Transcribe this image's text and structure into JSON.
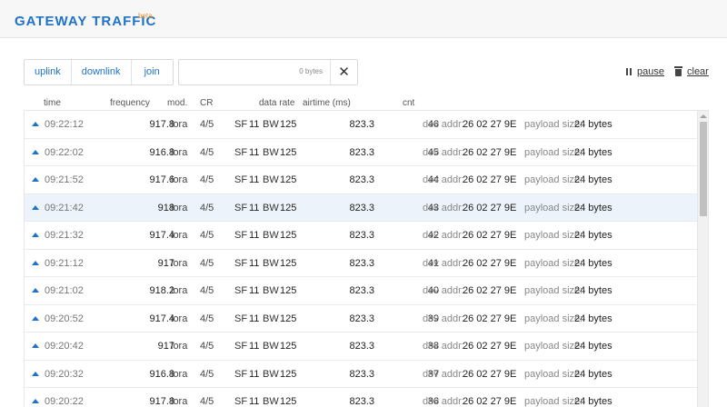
{
  "header": {
    "title": "GATEWAY TRAFFIC",
    "badge": "beta"
  },
  "filters": {
    "uplink": "uplink",
    "downlink": "downlink",
    "join": "join"
  },
  "search": {
    "size_text": "0 bytes",
    "clear_glyph": "✕"
  },
  "actions": {
    "pause": "pause",
    "clear": "clear"
  },
  "columns": {
    "time": "time",
    "frequency": "frequency",
    "mod": "mod.",
    "cr": "CR",
    "datarate": "data rate",
    "airtime": "airtime (ms)",
    "cnt": "cnt"
  },
  "labels": {
    "sf": "SF",
    "bw": "BW",
    "dev_addr": "dev addr:",
    "payload_size": "payload size:"
  },
  "rows": [
    {
      "time": "09:22:12",
      "frequency": "917.8",
      "mod": "lora",
      "cr": "4/5",
      "sf": "11",
      "bw": "125",
      "airtime": "823.3",
      "cnt": "46",
      "dev_addr": "26 02 27 9E",
      "payload": "24 bytes"
    },
    {
      "time": "09:22:02",
      "frequency": "916.8",
      "mod": "lora",
      "cr": "4/5",
      "sf": "11",
      "bw": "125",
      "airtime": "823.3",
      "cnt": "45",
      "dev_addr": "26 02 27 9E",
      "payload": "24 bytes"
    },
    {
      "time": "09:21:52",
      "frequency": "917.6",
      "mod": "lora",
      "cr": "4/5",
      "sf": "11",
      "bw": "125",
      "airtime": "823.3",
      "cnt": "44",
      "dev_addr": "26 02 27 9E",
      "payload": "24 bytes"
    },
    {
      "time": "09:21:42",
      "frequency": "918",
      "mod": "lora",
      "cr": "4/5",
      "sf": "11",
      "bw": "125",
      "airtime": "823.3",
      "cnt": "43",
      "dev_addr": "26 02 27 9E",
      "payload": "24 bytes"
    },
    {
      "time": "09:21:32",
      "frequency": "917.4",
      "mod": "lora",
      "cr": "4/5",
      "sf": "11",
      "bw": "125",
      "airtime": "823.3",
      "cnt": "42",
      "dev_addr": "26 02 27 9E",
      "payload": "24 bytes"
    },
    {
      "time": "09:21:12",
      "frequency": "917",
      "mod": "lora",
      "cr": "4/5",
      "sf": "11",
      "bw": "125",
      "airtime": "823.3",
      "cnt": "41",
      "dev_addr": "26 02 27 9E",
      "payload": "24 bytes"
    },
    {
      "time": "09:21:02",
      "frequency": "918.2",
      "mod": "lora",
      "cr": "4/5",
      "sf": "11",
      "bw": "125",
      "airtime": "823.3",
      "cnt": "40",
      "dev_addr": "26 02 27 9E",
      "payload": "24 bytes"
    },
    {
      "time": "09:20:52",
      "frequency": "917.4",
      "mod": "lora",
      "cr": "4/5",
      "sf": "11",
      "bw": "125",
      "airtime": "823.3",
      "cnt": "39",
      "dev_addr": "26 02 27 9E",
      "payload": "24 bytes"
    },
    {
      "time": "09:20:42",
      "frequency": "917",
      "mod": "lora",
      "cr": "4/5",
      "sf": "11",
      "bw": "125",
      "airtime": "823.3",
      "cnt": "38",
      "dev_addr": "26 02 27 9E",
      "payload": "24 bytes"
    },
    {
      "time": "09:20:32",
      "frequency": "916.8",
      "mod": "lora",
      "cr": "4/5",
      "sf": "11",
      "bw": "125",
      "airtime": "823.3",
      "cnt": "37",
      "dev_addr": "26 02 27 9E",
      "payload": "24 bytes"
    },
    {
      "time": "09:20:22",
      "frequency": "917.8",
      "mod": "lora",
      "cr": "4/5",
      "sf": "11",
      "bw": "125",
      "airtime": "823.3",
      "cnt": "36",
      "dev_addr": "26 02 27 9E",
      "payload": "24 bytes"
    }
  ],
  "selected_row_index": 3,
  "colors": {
    "accent": "#1e72c9",
    "badge": "#e8962f",
    "selected_row": "#edf3fb"
  }
}
